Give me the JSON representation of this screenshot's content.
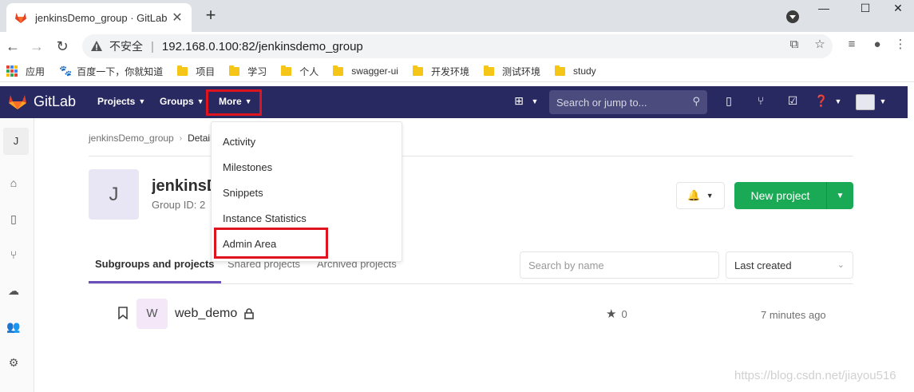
{
  "browser": {
    "tab_title": "jenkinsDemo_group · GitLab",
    "tab_close": "✕",
    "new_tab": "+",
    "window_controls": [
      "—",
      "☐",
      "✕"
    ],
    "insecure_label": "不安全",
    "url": "192.168.0.100:82/jenkinsdemo_group",
    "bookmarks": [
      "应用",
      "百度一下，你就知道",
      "项目",
      "学习",
      "个人",
      "swagger-ui",
      "开发环境",
      "测试环境",
      "study"
    ]
  },
  "gitlab_header": {
    "logo_text": "GitLab",
    "nav": {
      "projects": "Projects",
      "groups": "Groups",
      "more": "More"
    },
    "search_placeholder": "Search or jump to...",
    "icons": [
      "plus-square-icon",
      "screen-icon",
      "merge-request-icon",
      "todo-check-icon",
      "help-icon",
      "user-avatar-icon"
    ]
  },
  "sidebar": {
    "avatar_letter": "J",
    "icons": [
      "home-icon",
      "issues-icon",
      "merge-request-icon",
      "cloud-icon",
      "members-icon",
      "settings-icon"
    ]
  },
  "breadcrumb": {
    "group": "jenkinsDemo_group",
    "current": "Details"
  },
  "group": {
    "avatar_letter": "J",
    "name": "jenkinsDemo_group",
    "id_label": "Group ID: 2"
  },
  "actions": {
    "new_project": "New project"
  },
  "tabs": [
    {
      "label": "Subgroups and projects",
      "active": true
    },
    {
      "label": "Shared projects",
      "active": false
    },
    {
      "label": "Archived projects",
      "active": false
    }
  ],
  "filters": {
    "search_placeholder": "Search by name",
    "sort_value": "Last created"
  },
  "projects": [
    {
      "avatar_letter": "W",
      "name": "web_demo",
      "stars": "0",
      "updated": "7 minutes ago"
    }
  ],
  "more_menu": [
    "Activity",
    "Milestones",
    "Snippets",
    "Instance Statistics",
    "Admin Area"
  ],
  "watermark": "https://blog.csdn.net/jiayou516",
  "colors": {
    "header_bg": "#292961",
    "highlight_red": "#e0141e",
    "primary_green": "#1aaa55",
    "tab_active": "#6b4fbb"
  }
}
